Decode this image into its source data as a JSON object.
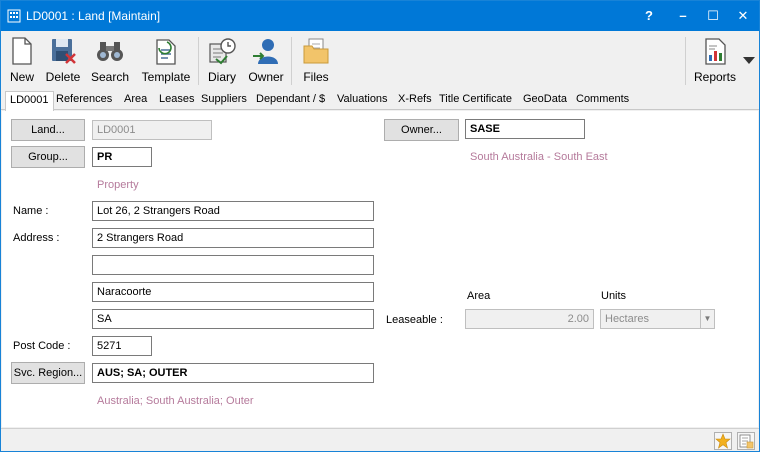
{
  "window": {
    "title": "LD0001 : Land [Maintain]",
    "controls": {
      "help": "?",
      "minimize": "–",
      "maximize": "☐",
      "close": "✕"
    },
    "accent": "#0078d7"
  },
  "toolbar": {
    "new": "New",
    "delete": "Delete",
    "search": "Search",
    "template": "Template",
    "diary": "Diary",
    "owner": "Owner",
    "files": "Files",
    "reports": "Reports"
  },
  "tabs": [
    "LD0001",
    "References",
    "Area",
    "Leases",
    "Suppliers",
    "Dependant / $",
    "Valuations",
    "X-Refs",
    "Title Certificate",
    "GeoData",
    "Comments"
  ],
  "form": {
    "land_button": "Land...",
    "land_code": "LD0001",
    "owner_button": "Owner...",
    "owner_code": "SASE",
    "owner_desc": "South Australia - South East",
    "group_button": "Group...",
    "group_code": "PR",
    "group_desc": "Property",
    "name_label": "Name :",
    "name_value": "Lot 26, 2 Strangers Road",
    "address_label": "Address :",
    "address_line1": "2 Strangers Road",
    "address_line2": "",
    "address_line3": "Naracoorte",
    "address_line4": "SA",
    "postcode_label": "Post Code :",
    "postcode_value": "5271",
    "svc_region_button": "Svc. Region...",
    "svc_region_value": "AUS; SA; OUTER",
    "svc_region_desc": "Australia; South Australia; Outer",
    "area_header": "Area",
    "units_header": "Units",
    "leaseable_label": "Leaseable :",
    "leaseable_value": "2.00",
    "units_value": "Hectares",
    "desc_color": "#b57a9b"
  },
  "icons": {
    "new": "new-document-icon",
    "delete": "delete-icon",
    "search": "binoculars-icon",
    "template": "template-icon",
    "diary": "diary-clock-icon",
    "owner": "owner-person-icon",
    "files": "folder-icon",
    "reports": "reports-icon",
    "favorite": "star-icon",
    "notes": "notes-icon"
  }
}
